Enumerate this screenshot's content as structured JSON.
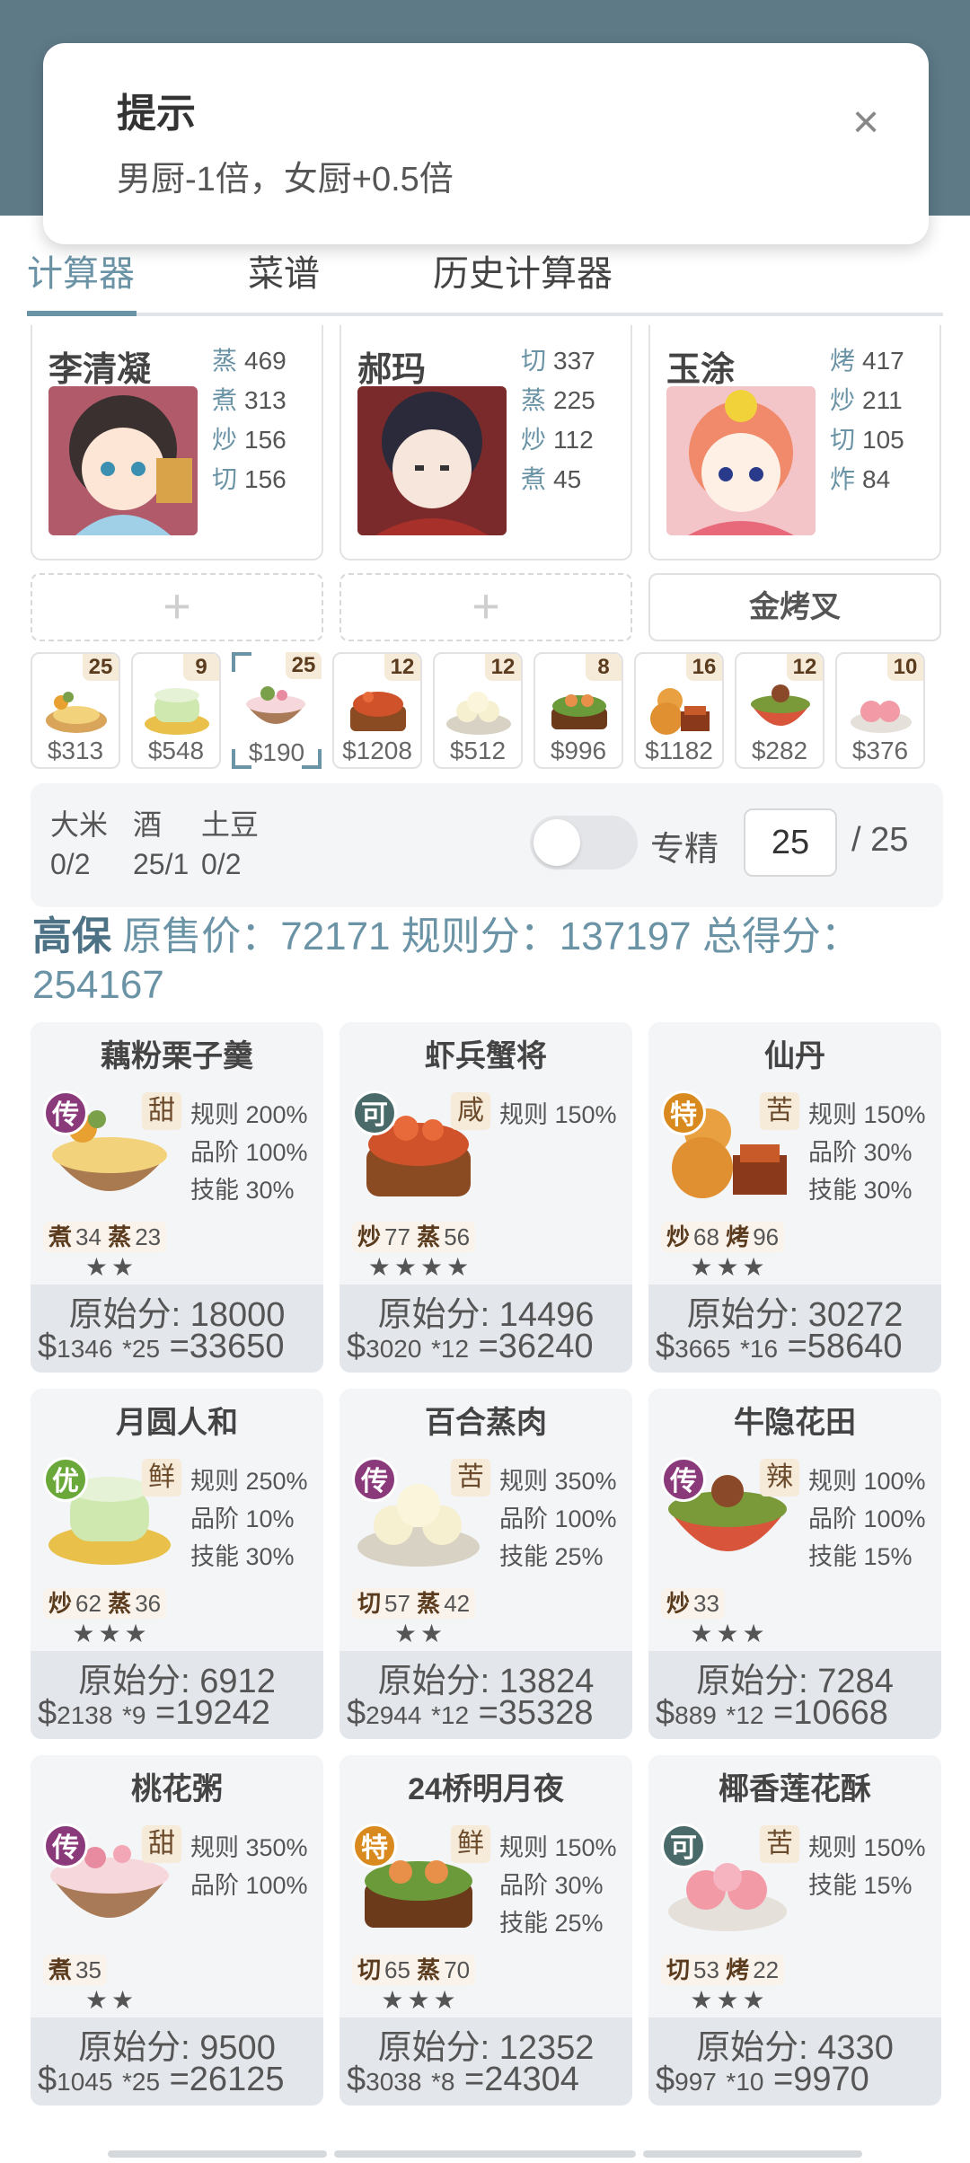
{
  "toast": {
    "title": "提示",
    "message": "男厨-1倍，女厨+0.5倍"
  },
  "tabs": [
    {
      "label": "计算器"
    },
    {
      "label": "菜谱"
    },
    {
      "label": "历史计算器"
    }
  ],
  "chefs": [
    {
      "name": "李清凝",
      "stats": [
        {
          "k": "蒸",
          "v": "469"
        },
        {
          "k": "煮",
          "v": "313"
        },
        {
          "k": "炒",
          "v": "156"
        },
        {
          "k": "切",
          "v": "156"
        }
      ]
    },
    {
      "name": "郝玛",
      "stats": [
        {
          "k": "切",
          "v": "337"
        },
        {
          "k": "蒸",
          "v": "225"
        },
        {
          "k": "炒",
          "v": "112"
        },
        {
          "k": "煮",
          "v": "45"
        }
      ]
    },
    {
      "name": "玉涂",
      "stats": [
        {
          "k": "烤",
          "v": "417"
        },
        {
          "k": "炒",
          "v": "211"
        },
        {
          "k": "切",
          "v": "105"
        },
        {
          "k": "炸",
          "v": "84"
        }
      ]
    }
  ],
  "slots": {
    "add_icon": "+",
    "equipment": "金烤叉"
  },
  "dish_strip": [
    {
      "count": "25",
      "price": "$313"
    },
    {
      "count": "9",
      "price": "$548"
    },
    {
      "count": "25",
      "price": "$190"
    },
    {
      "count": "12",
      "price": "$1208"
    },
    {
      "count": "12",
      "price": "$512"
    },
    {
      "count": "8",
      "price": "$996"
    },
    {
      "count": "16",
      "price": "$1182"
    },
    {
      "count": "12",
      "price": "$282"
    },
    {
      "count": "10",
      "price": "$376"
    }
  ],
  "ingredients": [
    {
      "name": "大米",
      "qty": "0/2"
    },
    {
      "name": "酒",
      "qty": "25/1"
    },
    {
      "name": "土豆",
      "qty": "0/2"
    }
  ],
  "specialize": {
    "label": "专精",
    "value": "25",
    "max": "/ 25"
  },
  "summary": {
    "tag": "高保",
    "text": "原售价：72171 规则分：137197 总得分：254167"
  },
  "cards": [
    {
      "title": "藕粉栗子羹",
      "rarity": "传",
      "rarity_color": "#8a3a7a",
      "flavor": "甜",
      "stats": [
        "规则 200%",
        "品阶 100%",
        "技能 30%"
      ],
      "skills": [
        {
          "k": "煮",
          "v": "34"
        },
        {
          "k": "蒸",
          "v": "23"
        }
      ],
      "stars": "★★",
      "raw": "原始分: 18000",
      "price": "1346",
      "mult": "*25",
      "total": "33650"
    },
    {
      "title": "虾兵蟹将",
      "rarity": "可",
      "rarity_color": "#4a6a6a",
      "flavor": "咸",
      "stats": [
        "规则 150%"
      ],
      "skills": [
        {
          "k": "炒",
          "v": "77"
        },
        {
          "k": "蒸",
          "v": "56"
        }
      ],
      "stars": "★★★★",
      "raw": "原始分: 14496",
      "price": "3020",
      "mult": "*12",
      "total": "36240"
    },
    {
      "title": "仙丹",
      "rarity": "特",
      "rarity_color": "#d98a1e",
      "flavor": "苦",
      "stats": [
        "规则 150%",
        "品阶 30%",
        "技能 30%"
      ],
      "skills": [
        {
          "k": "炒",
          "v": "68"
        },
        {
          "k": "烤",
          "v": "96"
        }
      ],
      "stars": "★★★",
      "raw": "原始分: 30272",
      "price": "3665",
      "mult": "*16",
      "total": "58640"
    },
    {
      "title": "月圆人和",
      "rarity": "优",
      "rarity_color": "#6aa83a",
      "flavor": "鲜",
      "stats": [
        "规则 250%",
        "品阶 10%",
        "技能 30%"
      ],
      "skills": [
        {
          "k": "炒",
          "v": "62"
        },
        {
          "k": "蒸",
          "v": "36"
        }
      ],
      "stars": "★★★",
      "raw": "原始分: 6912",
      "price": "2138",
      "mult": "*9",
      "total": "19242"
    },
    {
      "title": "百合蒸肉",
      "rarity": "传",
      "rarity_color": "#8a3a7a",
      "flavor": "苦",
      "stats": [
        "规则 350%",
        "品阶 100%",
        "技能 25%"
      ],
      "skills": [
        {
          "k": "切",
          "v": "57"
        },
        {
          "k": "蒸",
          "v": "42"
        }
      ],
      "stars": "★★",
      "raw": "原始分: 13824",
      "price": "2944",
      "mult": "*12",
      "total": "35328"
    },
    {
      "title": "牛隐花田",
      "rarity": "传",
      "rarity_color": "#8a3a7a",
      "flavor": "辣",
      "stats": [
        "规则 100%",
        "品阶 100%",
        "技能 15%"
      ],
      "skills": [
        {
          "k": "炒",
          "v": "33"
        }
      ],
      "stars": "★★★",
      "raw": "原始分: 7284",
      "price": "889",
      "mult": "*12",
      "total": "10668"
    },
    {
      "title": "桃花粥",
      "rarity": "传",
      "rarity_color": "#8a3a7a",
      "flavor": "甜",
      "stats": [
        "规则 350%",
        "品阶 100%"
      ],
      "skills": [
        {
          "k": "煮",
          "v": "35"
        }
      ],
      "stars": "★★",
      "raw": "原始分: 9500",
      "price": "1045",
      "mult": "*25",
      "total": "26125"
    },
    {
      "title": "24桥明月夜",
      "rarity": "特",
      "rarity_color": "#d98a1e",
      "flavor": "鲜",
      "stats": [
        "规则 150%",
        "品阶 30%",
        "技能 25%"
      ],
      "skills": [
        {
          "k": "切",
          "v": "65"
        },
        {
          "k": "蒸",
          "v": "70"
        }
      ],
      "stars": "★★★",
      "raw": "原始分: 12352",
      "price": "3038",
      "mult": "*8",
      "total": "24304"
    },
    {
      "title": "椰香莲花酥",
      "rarity": "可",
      "rarity_color": "#4a6a6a",
      "flavor": "苦",
      "stats": [
        "规则 150%",
        "技能 15%"
      ],
      "skills": [
        {
          "k": "切",
          "v": "53"
        },
        {
          "k": "烤",
          "v": "22"
        }
      ],
      "stars": "★★★",
      "raw": "原始分: 4330",
      "price": "997",
      "mult": "*10",
      "total": "9970"
    }
  ]
}
